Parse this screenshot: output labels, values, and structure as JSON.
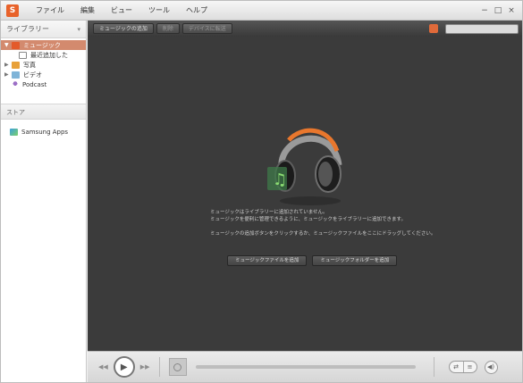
{
  "app": {
    "logo_icon": "app-logo-icon"
  },
  "menu": [
    "ファイル",
    "編集",
    "ビュー",
    "ツール",
    "ヘルプ"
  ],
  "window_controls": {
    "minimize": "−",
    "maximize": "□",
    "close": "×"
  },
  "sidebar": {
    "library_header": "ライブラリー",
    "items": [
      {
        "label": "ミュージック",
        "icon": "music-icon",
        "selected": true
      },
      {
        "label": "最近追加した",
        "icon": "recent-icon"
      },
      {
        "label": "写真",
        "icon": "photo-icon"
      },
      {
        "label": "ビデオ",
        "icon": "video-icon"
      },
      {
        "label": "Podcast",
        "icon": "podcast-icon"
      }
    ],
    "store_header": "ストア",
    "store_item": "Samsung Apps"
  },
  "toolbar": {
    "buttons": [
      "ミュージックの追加",
      "削除",
      "デバイスに転送"
    ],
    "sort_icon": "sort-icon",
    "search_placeholder": ""
  },
  "main": {
    "message_lines": [
      "ミュージックはライブラリーに追加されていません。",
      "ミュージックを便利に管理できるように、ミュージックをライブラリーに追加できます。",
      "ミュージックの追加ボタンをクリックするか、ミュージックファイルをここにドラッグしてください。"
    ],
    "buttons": [
      "ミュージックファイルを追加",
      "ミュージックフォルダーを追加"
    ],
    "illustration": "headphones-illustration"
  },
  "player": {
    "prev": "◀◀",
    "play": "▶",
    "next": "▶▶",
    "mode_buttons": [
      "⇄",
      "≡"
    ],
    "volume": "◀)"
  },
  "colors": {
    "accent": "#e35a2a",
    "selected": "#d38a6e",
    "main_bg": "#3b3b3b"
  }
}
